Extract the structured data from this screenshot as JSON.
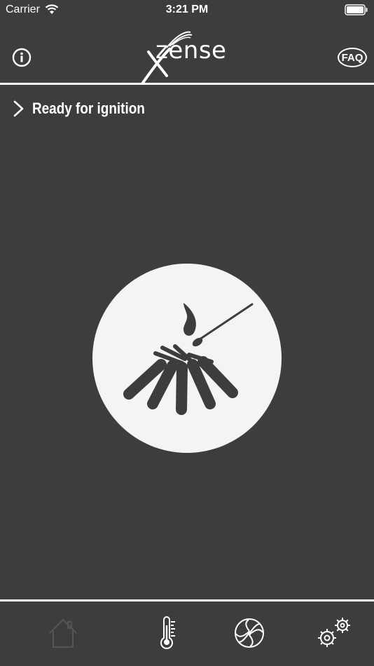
{
  "status_bar": {
    "carrier": "Carrier",
    "time": "3:21 PM"
  },
  "header": {
    "logo_text": "zense",
    "faq_label": "FAQ"
  },
  "status": {
    "text": "Ready for ignition"
  },
  "icons": {
    "info": "info-icon",
    "chevron": "chevron-right-icon",
    "ignition": "campfire-match-icon",
    "tabs": [
      "home-icon",
      "thermometer-icon",
      "fan-icon",
      "gears-icon"
    ]
  },
  "colors": {
    "background": "#3d3d3d",
    "foreground": "#ffffff",
    "circle": "#f4f4f4",
    "icon_dark": "#3d3d3d",
    "tab_inactive": "#555555"
  },
  "tabs": {
    "active_index": 0
  }
}
